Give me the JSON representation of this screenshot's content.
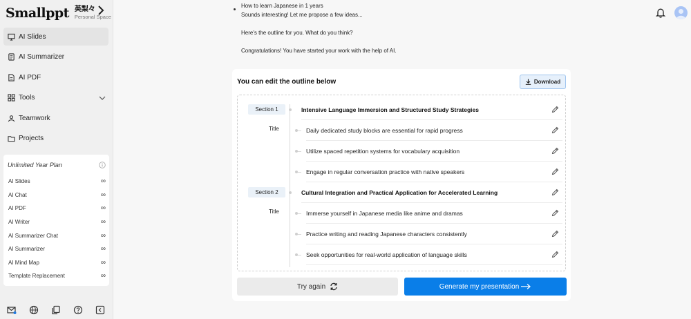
{
  "brand": {
    "logo": "Smallppt",
    "workspace_name": "英梨々",
    "workspace_sub": "Personal Space"
  },
  "nav": [
    {
      "label": "AI Slides",
      "icon": "presentation-icon",
      "active": true
    },
    {
      "label": "AI Summarizer",
      "icon": "summarize-icon"
    },
    {
      "label": "AI PDF",
      "icon": "pdf-icon"
    },
    {
      "label": "Tools",
      "icon": "grid-icon"
    },
    {
      "label": "Teamwork",
      "icon": "team-icon"
    },
    {
      "label": "Projects",
      "icon": "folder-icon"
    }
  ],
  "plan": {
    "title": "Unlimited Year Plan",
    "items": [
      {
        "label": "AI Slides",
        "value": "∞"
      },
      {
        "label": "AI Chat",
        "value": "∞"
      },
      {
        "label": "AI PDF",
        "value": "∞"
      },
      {
        "label": "AI Writer",
        "value": "∞"
      },
      {
        "label": "AI Summarizer Chat",
        "value": "∞"
      },
      {
        "label": "AI Summarizer",
        "value": "∞"
      },
      {
        "label": "AI Mind Map",
        "value": "∞"
      },
      {
        "label": "Template Replacement",
        "value": "∞"
      }
    ]
  },
  "chat": {
    "user_prompt": "How to learn Japanese in 1 years",
    "reply_1": "Sounds interesting! Let me propose a few ideas...",
    "reply_2": "Here's the outline for you. What do you think?",
    "reply_3": "Congratulations! You have started your work with the help of AI."
  },
  "outline": {
    "heading": "You can edit the outline below",
    "download_label": "Download",
    "title_tag": "Title",
    "sections": [
      {
        "tag": "Section 1",
        "title": "Intensive Language Immersion and Structured Study Strategies",
        "items": [
          "Daily dedicated study blocks are essential for rapid progress",
          "Utilize spaced repetition systems for vocabulary acquisition",
          "Engage in regular conversation practice with native speakers"
        ]
      },
      {
        "tag": "Section 2",
        "title": "Cultural Integration and Practical Application for Accelerated Learning",
        "items": [
          "Immerse yourself in Japanese media like anime and dramas",
          "Practice writing and reading Japanese characters consistently",
          "Seek opportunities for real-world application of language skills"
        ]
      }
    ],
    "try_again_label": "Try again",
    "generate_label": "Generate my presentation"
  }
}
